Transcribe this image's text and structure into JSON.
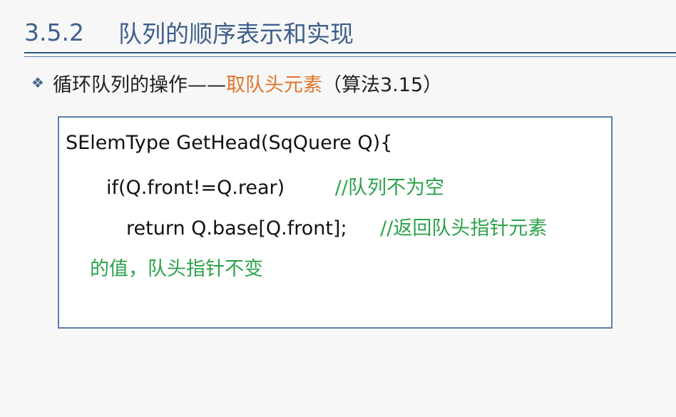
{
  "slide": {
    "section_number": "3.5.2",
    "section_title": "队列的顺序表示和实现"
  },
  "bullet": {
    "prefix": "循环队列的操作——",
    "highlight": "取队头元素",
    "suffix": "（算法3.15）"
  },
  "code": {
    "line1": "SElemType GetHead(SqQuere Q){",
    "line2_code": "if(Q.front!=Q.rear)",
    "line2_comment": "//队列不为空",
    "line3_code": "return  Q.base[Q.front];",
    "line3_comment": "//返回队头指针元素",
    "line4_comment": "的值，队头指针不变"
  },
  "colors": {
    "title": "#3f5f8c",
    "highlight": "#e0752b",
    "comment": "#2ca24b",
    "border": "#5b7fad"
  }
}
